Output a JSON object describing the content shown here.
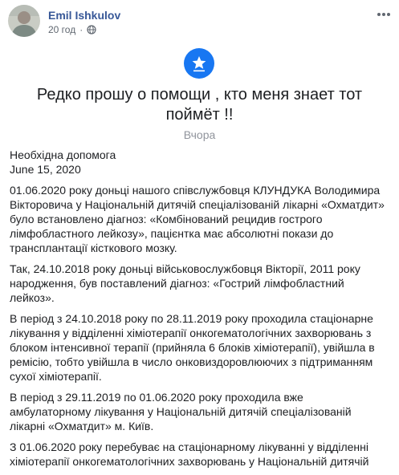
{
  "post": {
    "author": "Emil Ishkulov",
    "time": "20 год",
    "separator": "·",
    "title": "Редко прошу о помощи , кто меня знает тот поймёт !!",
    "date_label": "Вчора",
    "paragraphs": [
      "Необхідна допомога",
      "June 15, 2020",
      "01.06.2020 року доньці нашого співслужбовця КЛУНДУКА Володимира Вікторовича у Національній дитячій спеціалізованій лікарні «Охматдит» було встановлено діагноз: «Комбінований рецидив гострого лімфобластного лейкозу», пацієнтка має абсолютні покази до трансплантації кісткового мозку.",
      "Так, 24.10.2018 року доньці військовослужбовця Вікторії, 2011 року народження, був поставлений діагноз: «Гострий лімфобластний лейкоз».",
      "В період з 24.10.2018 року по 28.11.2019 року проходила стаціонарне лікування у відділенні хіміотерапії онкогематологічних захворювань з блоком інтенсивної терапії (прийняла 6 блоків хіміотерапії), увійшла в ремісію, тобто увійшла в число онковиздоровлюючих з підтриманням сухої хіміотерапії.",
      "В період з 29.11.2019 по 01.06.2020 року проходила вже амбулаторному лікування у Національній дитячій спеціалізованій лікарні «Охматдит» м. Київ.",
      "З 01.06.2020 року перебуває на стаціонарному лікуванні у відділенні хіміотерапії онкогематологічних захворювань у Національній дитячій"
    ]
  },
  "icons": {
    "avatar": "profile-photo",
    "privacy": "globe-icon",
    "more": "more-options-icon",
    "badge": "star-badge-icon"
  },
  "colors": {
    "author": "#385898",
    "badge": "#1877f2",
    "muted": "#606770",
    "text": "#1c1e21"
  }
}
